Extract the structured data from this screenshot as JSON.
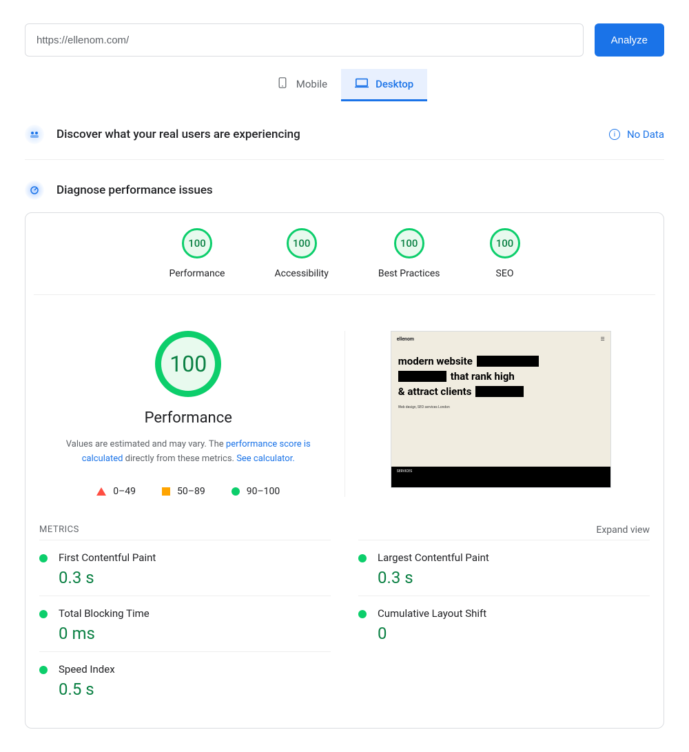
{
  "url_input": "https://ellenom.com/",
  "analyze_label": "Analyze",
  "tabs": {
    "mobile": "Mobile",
    "desktop": "Desktop"
  },
  "discover_title": "Discover what your real users are experiencing",
  "no_data": "No Data",
  "diagnose_title": "Diagnose performance issues",
  "scores": [
    {
      "value": "100",
      "label": "Performance"
    },
    {
      "value": "100",
      "label": "Accessibility"
    },
    {
      "value": "100",
      "label": "Best Practices"
    },
    {
      "value": "100",
      "label": "SEO"
    }
  ],
  "performance": {
    "big_score": "100",
    "title": "Performance",
    "desc_pre": "Values are estimated and may vary. The ",
    "desc_link1": "performance score is calculated",
    "desc_mid": " directly from these metrics. ",
    "desc_link2": "See calculator."
  },
  "legend": [
    {
      "range": "0–49"
    },
    {
      "range": "50–89"
    },
    {
      "range": "90–100"
    }
  ],
  "thumbnail": {
    "brand": "ellenom",
    "line1": "modern website",
    "line2": "that rank high",
    "line3": "& attract clients",
    "sub": "Web design, SEO services London",
    "footer": "SERVICES"
  },
  "metrics_header": "METRICS",
  "expand_label": "Expand view",
  "metrics": [
    {
      "name": "First Contentful Paint",
      "value": "0.3 s"
    },
    {
      "name": "Largest Contentful Paint",
      "value": "0.3 s"
    },
    {
      "name": "Total Blocking Time",
      "value": "0 ms"
    },
    {
      "name": "Cumulative Layout Shift",
      "value": "0"
    },
    {
      "name": "Speed Index",
      "value": "0.5 s"
    }
  ]
}
